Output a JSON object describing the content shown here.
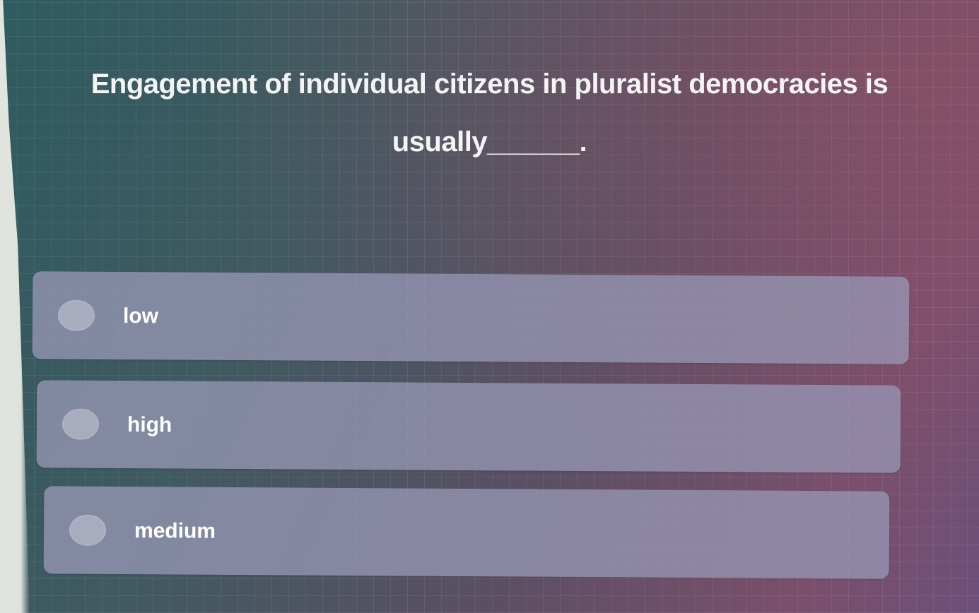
{
  "question": {
    "text": "Engagement of individual citizens in pluralist democracies is usually______."
  },
  "options": [
    {
      "label": "low"
    },
    {
      "label": "high"
    },
    {
      "label": "medium"
    }
  ],
  "colors": {
    "option_background": "#9797b4",
    "question_text": "#f4f4f4",
    "option_text": "#ffffff"
  }
}
